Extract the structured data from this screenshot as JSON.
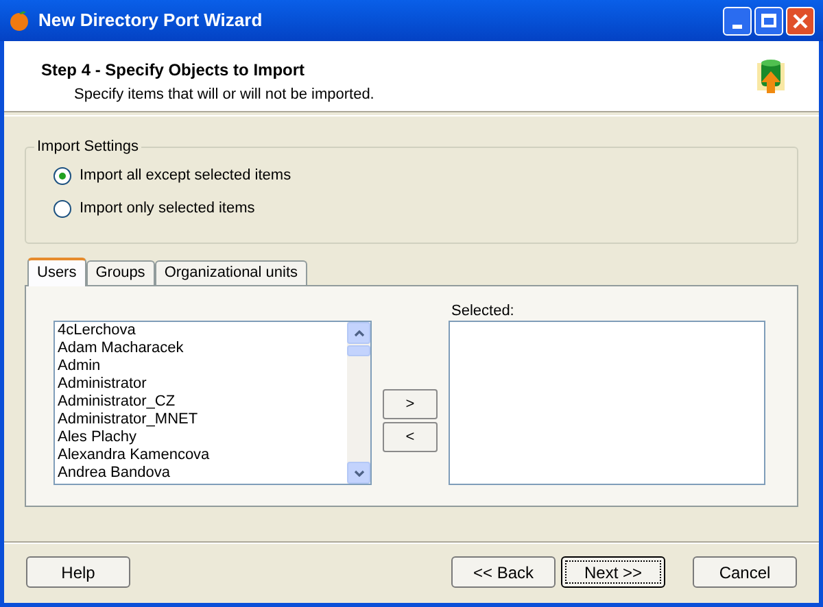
{
  "window": {
    "title": "New Directory Port Wizard"
  },
  "header": {
    "title": "Step 4 - Specify Objects to Import",
    "subtitle": "Specify items that will or will not be imported."
  },
  "import_settings": {
    "title": "Import Settings",
    "options": [
      {
        "label": "Import all except selected items",
        "selected": true
      },
      {
        "label": "Import only selected items",
        "selected": false
      }
    ]
  },
  "tabs": [
    {
      "label": "Users",
      "selected": true
    },
    {
      "label": "Groups",
      "selected": false
    },
    {
      "label": "Organizational units",
      "selected": false
    }
  ],
  "available_list": {
    "items": [
      "4cLerchova",
      "Adam Macharacek",
      "Admin",
      "Administrator",
      "Administrator_CZ",
      "Administrator_MNET",
      "Ales Plachy",
      "Alexandra Kamencova",
      "Andrea Bandova"
    ]
  },
  "move_buttons": [
    ">",
    "<"
  ],
  "selected_list": {
    "label": "Selected:"
  },
  "buttons": [
    {
      "label": "Help",
      "default": false
    },
    {
      "label": "<< Back",
      "default": false
    },
    {
      "label": "Next >>",
      "default": true
    },
    {
      "label": "Cancel",
      "default": false
    }
  ]
}
